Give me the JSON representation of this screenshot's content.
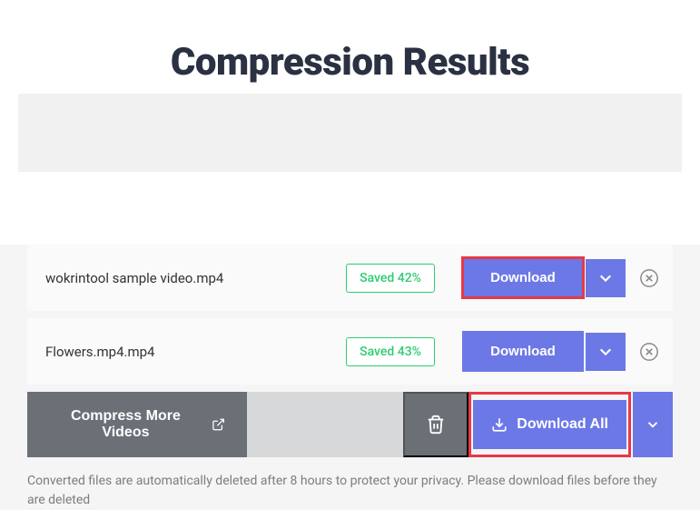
{
  "page": {
    "title": "Compression Results"
  },
  "files": [
    {
      "name": "wokrintool sample video.mp4",
      "saved": "Saved 42%",
      "download": "Download"
    },
    {
      "name": "Flowers.mp4.mp4",
      "saved": "Saved 43%",
      "download": "Download"
    }
  ],
  "actions": {
    "compress_more": "Compress More Videos",
    "download_all": "Download All"
  },
  "notice": "Converted files are automatically deleted after 8 hours to protect your privacy. Please download files before they are deleted"
}
